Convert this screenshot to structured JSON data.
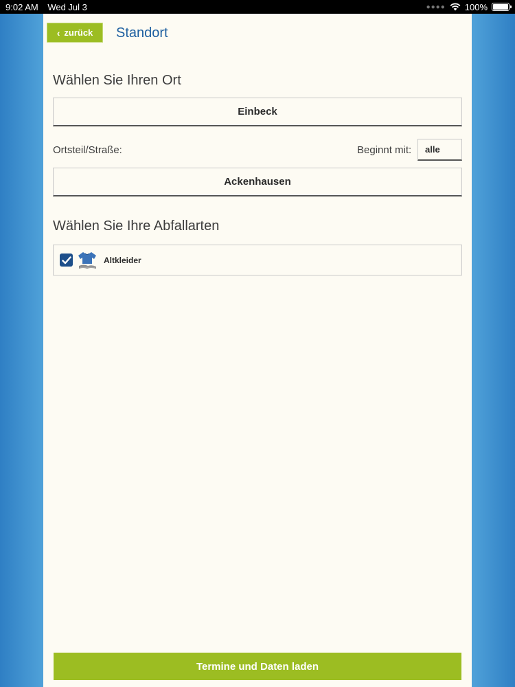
{
  "status_bar": {
    "time": "9:02 AM",
    "date": "Wed Jul 3",
    "battery": "100%"
  },
  "header": {
    "back_label": "zurück",
    "title": "Standort"
  },
  "location": {
    "heading": "Wählen Sie Ihren Ort",
    "selected_town": "Einbeck"
  },
  "street": {
    "label": "Ortsteil/Straße:",
    "filter_label": "Beginnt mit:",
    "filter_value": "alle",
    "selected_street": "Ackenhausen"
  },
  "waste": {
    "heading": "Wählen Sie Ihre Abfallarten",
    "items": [
      {
        "label": "Altkleider",
        "checked": true,
        "icon": "clothing-icon"
      }
    ]
  },
  "footer": {
    "load_label": "Termine und Daten laden"
  },
  "colors": {
    "accent_green": "#9cbd22",
    "title_blue": "#1d5fa0",
    "checkbox_blue": "#1d4f8a",
    "panel_bg": "#fdfbf3"
  }
}
